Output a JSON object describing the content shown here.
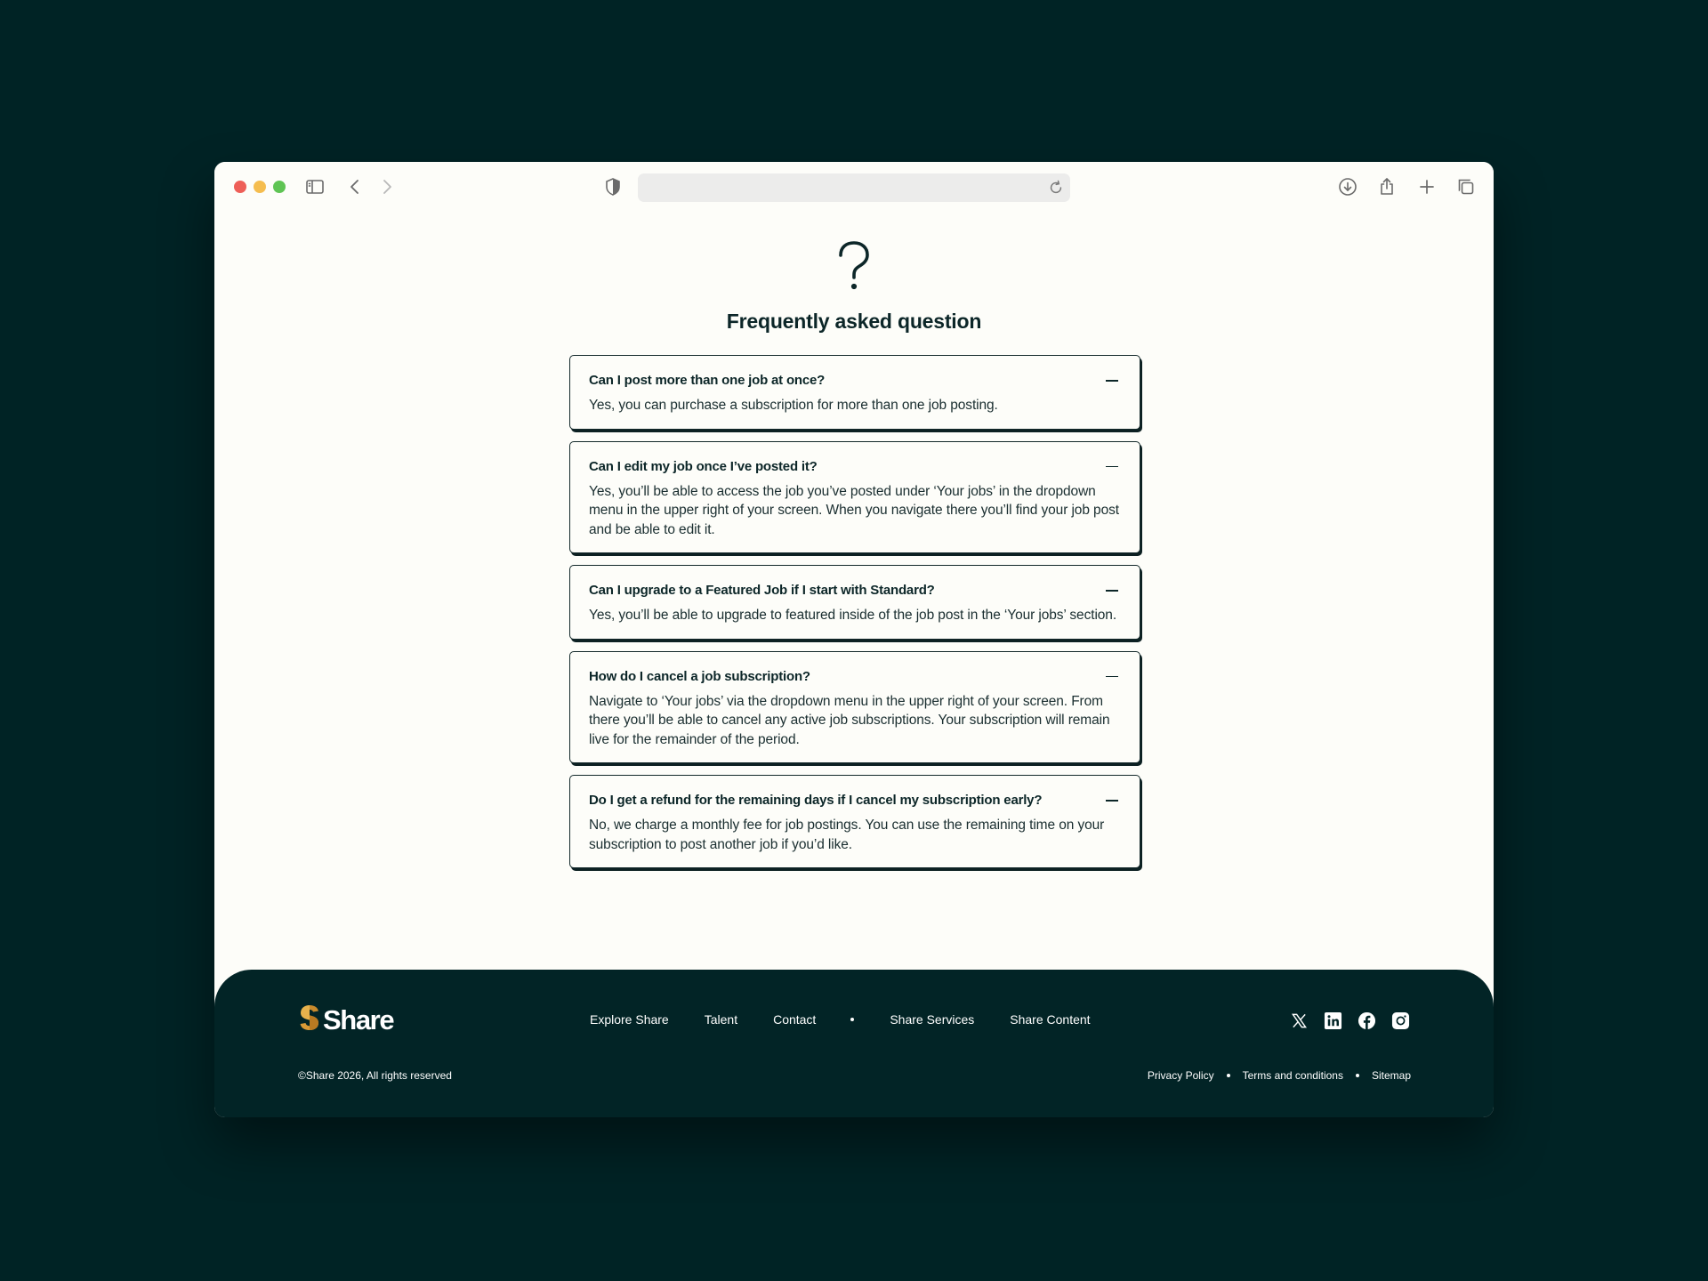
{
  "browser": {
    "address_value": "",
    "traffic_lights": {
      "close": "#ee5f58",
      "minimize": "#f5bd4f",
      "maximize": "#5fc454"
    },
    "icons": [
      "sidebar-icon",
      "back-icon",
      "forward-icon",
      "shield-icon",
      "reload-icon",
      "download-icon",
      "share-icon",
      "new-tab-icon",
      "tabs-overview-icon"
    ]
  },
  "page": {
    "icon": "question-mark",
    "title": "Frequently asked question"
  },
  "faq": [
    {
      "question": "Can I post more than one job at once?",
      "answer": "Yes, you can purchase a subscription for more than one job posting."
    },
    {
      "question": "Can I edit my job once I’ve posted it?",
      "answer": "Yes, you’ll be able to access the job you’ve posted under ‘Your jobs’ in the dropdown menu in the upper right of your screen. When you navigate there you’ll find your job post and be able to edit it."
    },
    {
      "question": "Can I upgrade to a Featured Job if I start with Standard?",
      "answer": "Yes, you’ll be able to upgrade to featured inside of the job post in the ‘Your jobs’ section."
    },
    {
      "question": "How do I cancel a job subscription?",
      "answer": "Navigate to ‘Your jobs’ via the dropdown menu in the upper right of your screen. From there you’ll be able to cancel any active job subscriptions. Your subscription will remain live for the remainder of the period."
    },
    {
      "question": "Do I get a refund for the remaining days if I cancel my subscription early?",
      "answer": "No, we charge a monthly fee for job postings. You can use the remaining time on your subscription to post another job if you’d like."
    }
  ],
  "footer": {
    "logo_text": "Share",
    "nav": {
      "explore": "Explore Share",
      "talent": "Talent",
      "contact": "Contact",
      "services": "Share Services",
      "content": "Share Content"
    },
    "social_icons": [
      "x-icon",
      "linkedin-icon",
      "facebook-icon",
      "instagram-icon"
    ],
    "copyright": "©Share 2026, All rights reserved",
    "legal": {
      "privacy": "Privacy Policy",
      "terms": "Terms and conditions",
      "sitemap": "Sitemap"
    }
  },
  "colors": {
    "background": "#002325",
    "page_bg": "#fdfdf9",
    "text_dark": "#0c2628",
    "footer_bg": "#022426",
    "logo_gold": "#e0a640"
  }
}
